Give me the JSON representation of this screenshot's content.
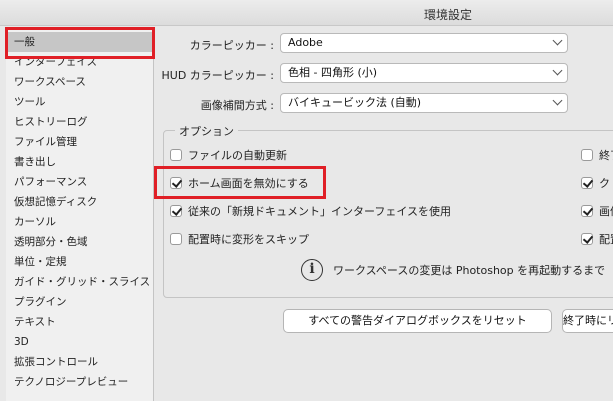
{
  "window": {
    "title": "環境設定"
  },
  "sidebar": {
    "items": [
      {
        "label": "一般"
      },
      {
        "label": "インターフェイス"
      },
      {
        "label": "ワークスペース"
      },
      {
        "label": "ツール"
      },
      {
        "label": "ヒストリーログ"
      },
      {
        "label": "ファイル管理"
      },
      {
        "label": "書き出し"
      },
      {
        "label": "パフォーマンス"
      },
      {
        "label": "仮想記憶ディスク"
      },
      {
        "label": "カーソル"
      },
      {
        "label": "透明部分・色域"
      },
      {
        "label": "単位・定規"
      },
      {
        "label": "ガイド・グリッド・スライス"
      },
      {
        "label": "プラグイン"
      },
      {
        "label": "テキスト"
      },
      {
        "label": "3D"
      },
      {
        "label": "拡張コントロール"
      },
      {
        "label": "テクノロジープレビュー"
      }
    ]
  },
  "general": {
    "color_picker": {
      "label": "カラーピッカー :",
      "value": "Adobe"
    },
    "hud_color_picker": {
      "label": "HUD カラーピッカー :",
      "value": "色相 - 四角形 (小)"
    },
    "interpolation": {
      "label": "画像補間方式 :",
      "value": "バイキュービック法 (自動)"
    }
  },
  "options": {
    "legend": "オプション",
    "left": [
      {
        "label": "ファイルの自動更新",
        "checked": false
      },
      {
        "label": "ホーム画面を無効にする",
        "checked": true
      },
      {
        "label": "従来の「新規ドキュメント」インターフェイスを使用",
        "checked": true
      },
      {
        "label": "配置時に変形をスキップ",
        "checked": false
      }
    ],
    "right": [
      {
        "label": "終了",
        "checked": false
      },
      {
        "label": "ク",
        "checked": true
      },
      {
        "label": "画像",
        "checked": true
      },
      {
        "label": "配置",
        "checked": true
      }
    ],
    "info": "ワークスペースの変更は Photoshop を再起動するまで"
  },
  "buttons": {
    "reset_warnings": "すべての警告ダイアログボックスをリセット",
    "reset_on_quit": "終了時にリセット"
  }
}
